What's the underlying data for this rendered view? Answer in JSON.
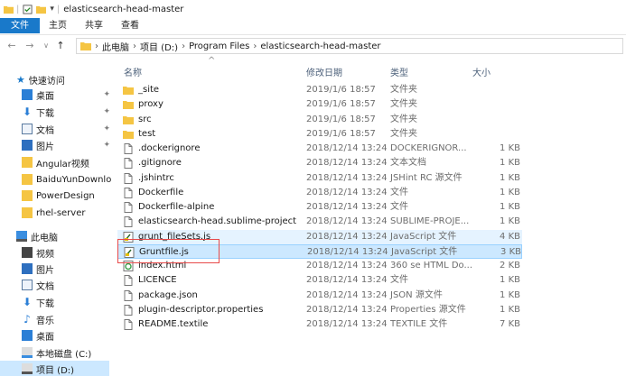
{
  "window": {
    "title": "elasticsearch-head-master"
  },
  "ribbon": {
    "tabs": [
      "文件",
      "主页",
      "共享",
      "查看"
    ]
  },
  "address": {
    "crumbs": [
      "此电脑",
      "项目 (D:)",
      "Program Files",
      "elasticsearch-head-master"
    ]
  },
  "sidebar": {
    "quick_access": "快速访问",
    "quick_items": [
      "桌面",
      "下载",
      "文档",
      "图片",
      "Angular视频",
      "BaiduYunDownloa",
      "PowerDesign",
      "rhel-server"
    ],
    "this_pc": "此电脑",
    "pc_items": [
      "视频",
      "图片",
      "文档",
      "下载",
      "音乐",
      "桌面",
      "本地磁盘 (C:)",
      "项目 (D:)"
    ]
  },
  "columns": {
    "name": "名称",
    "date": "修改日期",
    "type": "类型",
    "size": "大小"
  },
  "files": [
    {
      "name": "_site",
      "date": "2019/1/6 18:57",
      "type": "文件夹",
      "size": "",
      "icon": "folder-icon"
    },
    {
      "name": "proxy",
      "date": "2019/1/6 18:57",
      "type": "文件夹",
      "size": "",
      "icon": "folder-icon"
    },
    {
      "name": "src",
      "date": "2019/1/6 18:57",
      "type": "文件夹",
      "size": "",
      "icon": "folder-icon"
    },
    {
      "name": "test",
      "date": "2019/1/6 18:57",
      "type": "文件夹",
      "size": "",
      "icon": "folder-icon"
    },
    {
      "name": ".dockerignore",
      "date": "2018/12/14 13:24",
      "type": "DOCKERIGNOR...",
      "size": "1 KB",
      "icon": "file-icon"
    },
    {
      "name": ".gitignore",
      "date": "2018/12/14 13:24",
      "type": "文本文档",
      "size": "1 KB",
      "icon": "file-icon"
    },
    {
      "name": ".jshintrc",
      "date": "2018/12/14 13:24",
      "type": "JSHint RC 源文件",
      "size": "1 KB",
      "icon": "file-icon"
    },
    {
      "name": "Dockerfile",
      "date": "2018/12/14 13:24",
      "type": "文件",
      "size": "1 KB",
      "icon": "file-icon"
    },
    {
      "name": "Dockerfile-alpine",
      "date": "2018/12/14 13:24",
      "type": "文件",
      "size": "1 KB",
      "icon": "file-icon"
    },
    {
      "name": "elasticsearch-head.sublime-project",
      "date": "2018/12/14 13:24",
      "type": "SUBLIME-PROJE...",
      "size": "1 KB",
      "icon": "file-icon"
    },
    {
      "name": "grunt_fileSets.js",
      "date": "2018/12/14 13:24",
      "type": "JavaScript 文件",
      "size": "4 KB",
      "icon": "js-file-icon"
    },
    {
      "name": "Gruntfile.js",
      "date": "2018/12/14 13:24",
      "type": "JavaScript 文件",
      "size": "3 KB",
      "icon": "js-file-icon"
    },
    {
      "name": "index.html",
      "date": "2018/12/14 13:24",
      "type": "360 se HTML Do...",
      "size": "2 KB",
      "icon": "html-file-icon"
    },
    {
      "name": "LICENCE",
      "date": "2018/12/14 13:24",
      "type": "文件",
      "size": "1 KB",
      "icon": "file-icon"
    },
    {
      "name": "package.json",
      "date": "2018/12/14 13:24",
      "type": "JSON 源文件",
      "size": "1 KB",
      "icon": "file-icon"
    },
    {
      "name": "plugin-descriptor.properties",
      "date": "2018/12/14 13:24",
      "type": "Properties 源文件",
      "size": "1 KB",
      "icon": "file-icon"
    },
    {
      "name": "README.textile",
      "date": "2018/12/14 13:24",
      "type": "TEXTILE 文件",
      "size": "7 KB",
      "icon": "file-icon"
    }
  ],
  "colors": {
    "accent": "#1979ca",
    "selection": "#cce8ff",
    "hover": "#e5f3ff",
    "highlight_box": "#e84a4a",
    "folder": "#f5c543"
  }
}
